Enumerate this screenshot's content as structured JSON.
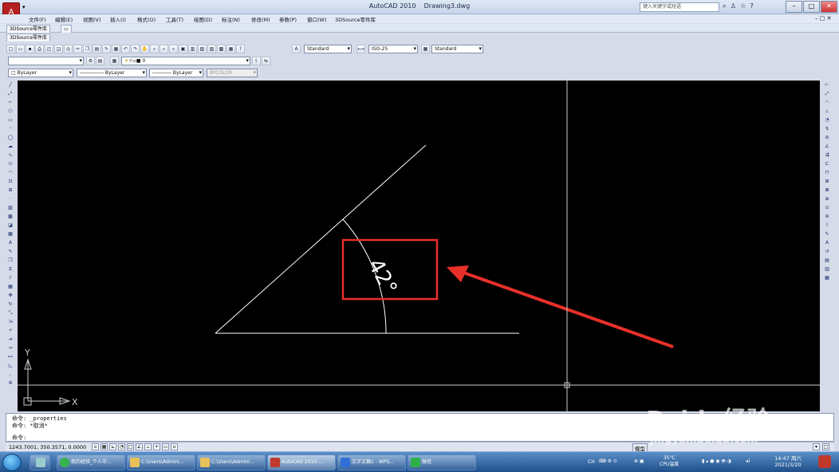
{
  "window": {
    "app_title": "AutoCAD 2010",
    "file_title": "Drawing3.dwg",
    "search_placeholder": "键入关键字或短语"
  },
  "menu": [
    "文件(F)",
    "编辑(E)",
    "视图(V)",
    "插入(I)",
    "格式(O)",
    "工具(T)",
    "绘图(D)",
    "标注(N)",
    "修改(M)",
    "参数(P)",
    "窗口(W)",
    "3DSource零件库"
  ],
  "tabs": {
    "row1": "3DSource零件库",
    "row2": "3DSource零件库"
  },
  "styles": {
    "text_style": "Standard",
    "dim_style": "ISO-25",
    "table_style": "Standard"
  },
  "layer": {
    "name": "0"
  },
  "properties": {
    "color": "ByLayer",
    "linetype": "ByLayer",
    "lineweight": "ByLayer",
    "plotstyle": "BYCOLOR"
  },
  "drawing": {
    "angle_text": "42°",
    "ucs_x": "X",
    "ucs_y": "Y"
  },
  "command": {
    "line1": "命令: _properties",
    "line2": "命令: *取消*",
    "line3": "命令:"
  },
  "status": {
    "coords": "1243.7001, 350.3571, 0.0000",
    "model": "模型"
  },
  "taskbar": {
    "items": [
      "我的经验_个人中...",
      "C:\\Users\\Admini...",
      "C:\\Users\\Admini...",
      "AutoCAD 2010 -...",
      "文字文稿1 - WPS...",
      "微信"
    ]
  },
  "tray": {
    "lang": "CH",
    "temp": "35°C",
    "cpu": "CPU温度",
    "time": "14:47 周六",
    "date": "2021/3/20"
  },
  "watermark": {
    "logo": "Baidu经验",
    "url": "jingyan.baidu.com"
  },
  "colors": {
    "highlight": "#e8302a",
    "canvas": "#000000"
  }
}
